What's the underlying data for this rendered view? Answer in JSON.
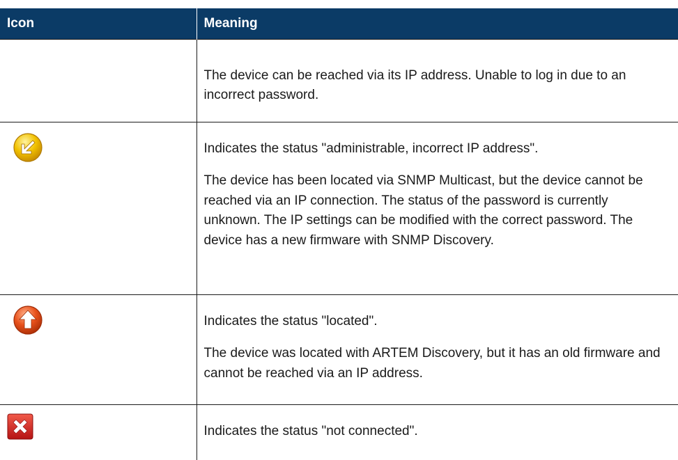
{
  "table": {
    "headers": {
      "icon": "Icon",
      "meaning": "Meaning"
    },
    "rows": [
      {
        "icon": "",
        "paragraphs": [
          "The device can be reached via its IP address. Unable to log in due to an incorrect password."
        ]
      },
      {
        "icon": "yellow-arrow-down-left-icon",
        "paragraphs": [
          "Indicates the status \"administrable, incorrect IP address\".",
          "The device has been located via SNMP Multicast, but the device cannot be reached via an IP connection. The status of the password is currently unknown. The IP settings can be modified with the correct password. The device has a new firmware with SNMP Discovery."
        ]
      },
      {
        "icon": "orange-arrow-up-icon",
        "paragraphs": [
          "Indicates the status \"located\".",
          "The device was located with ARTEM Discovery, but it has an old firmware and cannot be reached via an IP address."
        ]
      },
      {
        "icon": "red-x-icon",
        "paragraphs": [
          "Indicates the status \"not connected\"."
        ]
      }
    ]
  },
  "colors": {
    "header_bg": "#0b3b66",
    "header_text": "#ffffff",
    "border": "#1a1a1a",
    "icon_yellow": "#f2c200",
    "icon_orange": "#e8521c",
    "icon_red": "#d42020"
  }
}
